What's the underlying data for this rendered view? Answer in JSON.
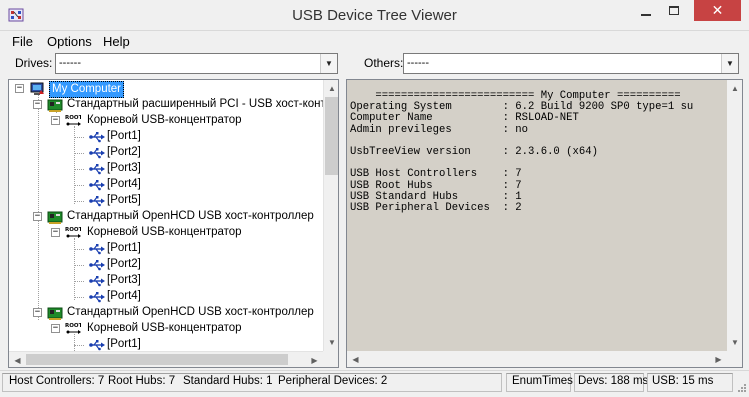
{
  "window": {
    "title": "USB Device Tree Viewer",
    "icon": "usb-tree-app-icon",
    "close_color": "#c74343"
  },
  "menu": {
    "items": [
      "File",
      "Options",
      "Help"
    ]
  },
  "toolbar": {
    "drives_label": "Drives:",
    "drives_value": "------",
    "others_label": "Others:",
    "others_value": "------"
  },
  "tree": {
    "root_label": "My Computer",
    "controllers": [
      {
        "label": "Стандартный расширенный PCI - USB хост-контроллер",
        "hub_label": "Корневой USB-концентратор",
        "ports": [
          "[Port1]",
          "[Port2]",
          "[Port3]",
          "[Port4]",
          "[Port5]"
        ]
      },
      {
        "label": "Стандартный OpenHCD USB хост-контроллер",
        "hub_label": "Корневой USB-концентратор",
        "ports": [
          "[Port1]",
          "[Port2]",
          "[Port3]",
          "[Port4]"
        ]
      },
      {
        "label": "Стандартный OpenHCD USB хост-контроллер",
        "hub_label": "Корневой USB-концентратор",
        "ports": [
          "[Port1]"
        ]
      }
    ],
    "icons": {
      "computer": "computer-icon",
      "controller": "pci-card-icon",
      "hub": "root-hub-icon",
      "port": "usb-port-icon"
    },
    "selection_color": "#3399ff"
  },
  "info": {
    "lines": [
      "    ========================= My Computer ==========",
      "Operating System        : 6.2 Build 9200 SP0 type=1 su",
      "Computer Name           : RSLOAD-NET",
      "Admin previleges        : no",
      "",
      "UsbTreeView version     : 2.3.6.0 (x64)",
      "",
      "USB Host Controllers    : 7",
      "USB Root Hubs           : 7",
      "USB Standard Hubs       : 1",
      "USB Peripheral Devices  : 2"
    ],
    "background": "#d4d0c8"
  },
  "status": {
    "host_controllers": "Host Controllers: 7",
    "root_hubs": "Root Hubs: 7",
    "standard_hubs": "Standard Hubs: 1",
    "peripheral_devices": "Peripheral Devices: 2",
    "enum_times": "EnumTimes",
    "devs": "Devs: 188 ms",
    "usb": "USB: 15 ms"
  }
}
